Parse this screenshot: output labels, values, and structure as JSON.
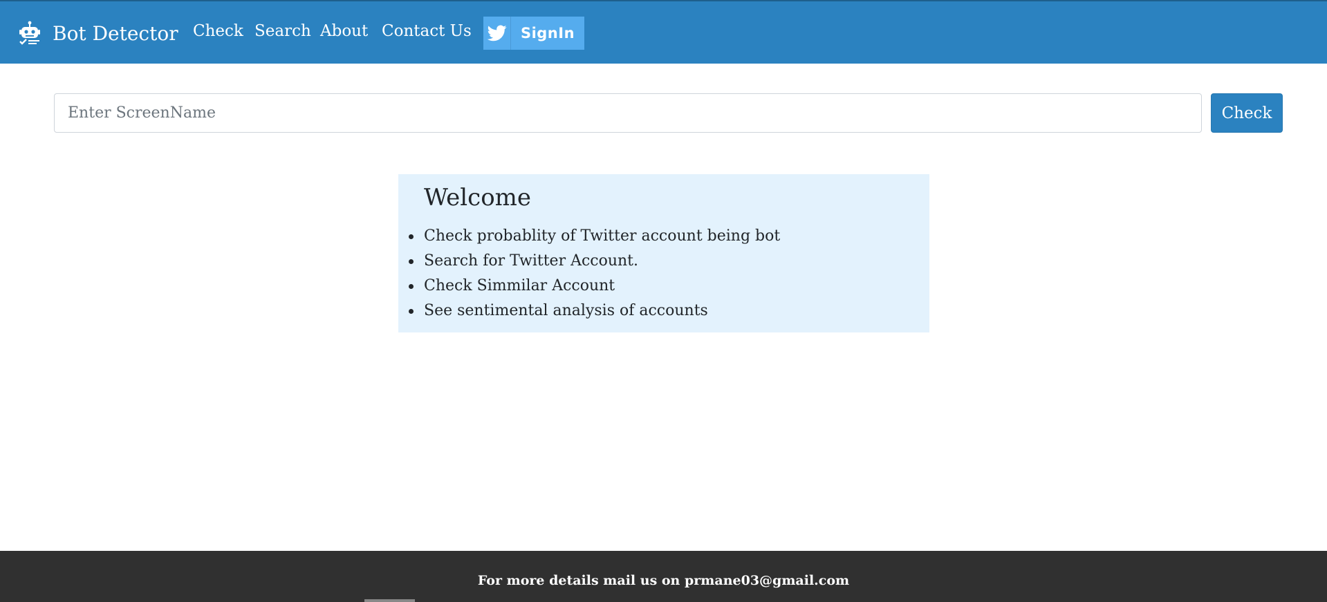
{
  "colors": {
    "navbar_bg": "#2b82c0",
    "twitter_blue": "#55acee",
    "welcome_bg": "#e3f2fd",
    "footer_bg": "#303030"
  },
  "navbar": {
    "brand_icon": "robot-icon",
    "brand_title": "Bot Detector",
    "links": [
      {
        "label": "Check"
      },
      {
        "label": "Search"
      },
      {
        "label": "About"
      },
      {
        "label": "Contact Us"
      }
    ],
    "signin": {
      "icon": "twitter-bird-icon",
      "label": "SignIn"
    }
  },
  "search": {
    "placeholder": "Enter ScreenName",
    "value": "",
    "button_label": "Check"
  },
  "welcome": {
    "title": "Welcome",
    "items": [
      "Check probablity of Twitter account being bot",
      "Search for Twitter Account.",
      "Check Simmilar Account",
      "See sentimental analysis of accounts"
    ]
  },
  "footer": {
    "text": "For more details mail us on prmane03@gmail.com"
  }
}
